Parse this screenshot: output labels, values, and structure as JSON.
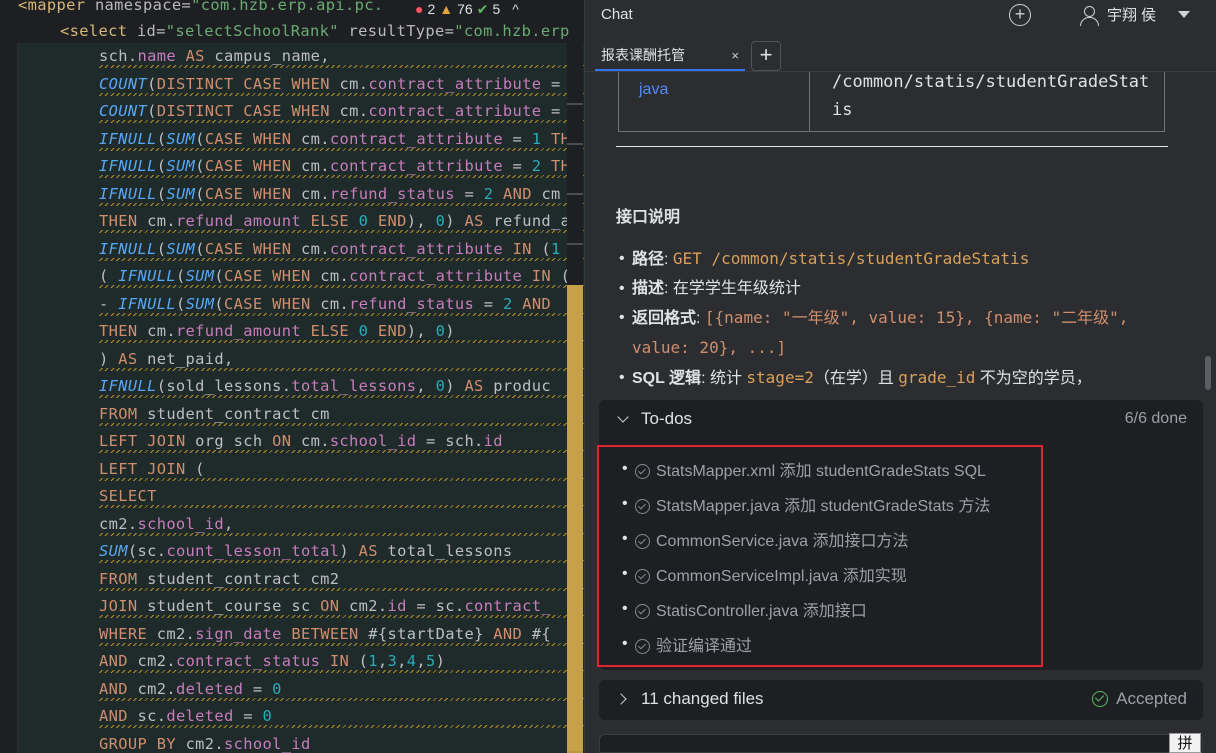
{
  "editor": {
    "header_line_1": "<mapper namespace=\"com.hzb.erp.api.pc.",
    "inspections": {
      "errors": "2",
      "warnings": "76",
      "ok": "5"
    },
    "header_line_2": "<select id=\"selectSchoolRank\" resultType=\"com.hzb.erp",
    "lines": [
      "sch.name AS campus_name,",
      "COUNT(DISTINCT CASE WHEN cm.contract_attribute =",
      "COUNT(DISTINCT CASE WHEN cm.contract_attribute =",
      "IFNULL(SUM(CASE WHEN cm.contract_attribute = 1 TH",
      "IFNULL(SUM(CASE WHEN cm.contract_attribute = 2 TH",
      "IFNULL(SUM(CASE WHEN cm.refund_status = 2 AND cm",
      "THEN cm.refund_amount ELSE 0 END), 0) AS refund_a",
      "IFNULL(SUM(CASE WHEN cm.contract_attribute IN (1",
      "( IFNULL(SUM(CASE WHEN cm.contract_attribute IN (",
      "- IFNULL(SUM(CASE WHEN cm.refund_status = 2 AND",
      "THEN cm.refund_amount ELSE 0 END), 0)",
      ") AS net_paid,",
      "IFNULL(sold_lessons.total_lessons, 0) AS produc",
      "FROM student_contract cm",
      "LEFT JOIN org sch ON cm.school_id = sch.id",
      "LEFT JOIN (",
      "SELECT",
      "cm2.school_id,",
      "SUM(sc.count_lesson_total) AS total_lessons",
      "FROM student_contract cm2",
      "JOIN student_course sc ON cm2.id = sc.contract_",
      "WHERE cm2.sign_date BETWEEN #{startDate} AND #{",
      "AND cm2.contract_status IN (1,3,4,5)",
      "AND cm2.deleted = 0",
      "AND sc.deleted = 0",
      "GROUP BY cm2.school_id"
    ]
  },
  "chat": {
    "title": "Chat",
    "user_name": "宇翔 侯",
    "tab_label": "报表课酬托管",
    "tab_close": "×",
    "tab_add": "+",
    "table_cell_lang": "java",
    "table_cell_path": "/common/statis/studentGradeStatis",
    "section_heading": "接口说明",
    "bullets": [
      {
        "label": "路径",
        "text": ": GET /common/statis/studentGradeStatis"
      },
      {
        "label": "描述",
        "text": ": 在学学生年级统计"
      },
      {
        "label": "返回格式",
        "text": ": [{name: \"一年级\", value: 15}, {name: \"二年级\", value: 20}, ...]"
      },
      {
        "label": "SQL 逻辑",
        "text": ": 统计 stage=2（在学）且 grade_id 不为空的学员，"
      }
    ],
    "todos": {
      "title": "To-dos",
      "count": "6/6 done",
      "items": [
        "StatsMapper.xml 添加 studentGradeStats SQL",
        "StatsMapper.java 添加 studentGradeStats 方法",
        "CommonService.java 添加接口方法",
        "CommonServiceImpl.java 添加实现",
        "StatisController.java 添加接口",
        "验证编译通过"
      ]
    },
    "changed_files": "11 changed files",
    "accepted": "Accepted",
    "ime_label": "拼"
  },
  "colors": {
    "accent": "#3574f0",
    "highlight_box": "#e0232d",
    "accepted_green": "#5fb865"
  }
}
